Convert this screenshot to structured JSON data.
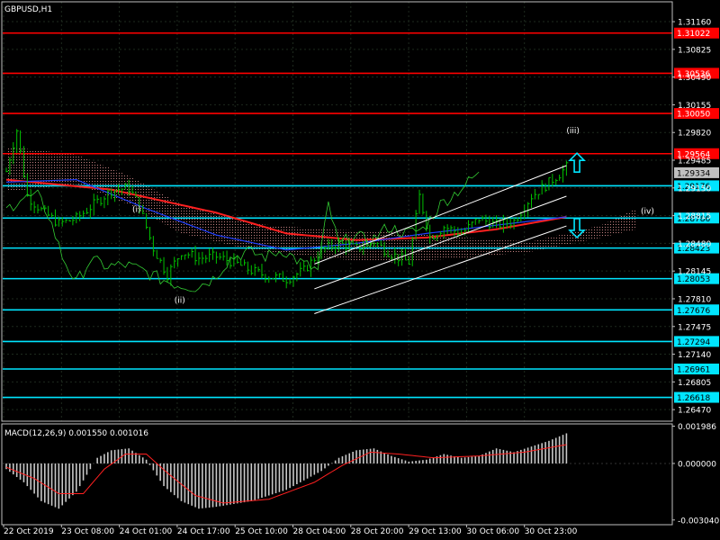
{
  "chart_data": [
    {
      "type": "line",
      "title": "GBPUSD,H1",
      "price_axis": {
        "ticks": [
          1.3116,
          1.30825,
          1.3049,
          1.30155,
          1.2982,
          1.29485,
          1.2915,
          1.28815,
          1.2848,
          1.28145,
          1.2781,
          1.27475,
          1.2714,
          1.26805,
          1.2647
        ],
        "tick_labels": [
          "1.31160",
          "1.30825",
          "1.30490",
          "1.30155",
          "1.29820",
          "1.29485",
          "1.29150",
          "1.28815",
          "1.28480",
          "1.28145",
          "1.27810",
          "1.27475",
          "1.27140",
          "1.26805",
          "1.26470"
        ],
        "range": [
          1.2633,
          1.314
        ]
      },
      "time_axis": {
        "labels": [
          "22 Oct 2019",
          "23 Oct 08:00",
          "24 Oct 01:00",
          "24 Oct 17:00",
          "25 Oct 10:00",
          "28 Oct 04:00",
          "28 Oct 20:00",
          "29 Oct 13:00",
          "30 Oct 06:00",
          "30 Oct 23:00"
        ],
        "bars_total": 176
      },
      "grid": true,
      "resistance_levels": [
        {
          "value": 1.31022,
          "label": "1.31022",
          "color": "#ff0000"
        },
        {
          "value": 1.30536,
          "label": "1.30536",
          "color": "#ff0000"
        },
        {
          "value": 1.3005,
          "label": "1.30050",
          "color": "#ff0000"
        },
        {
          "value": 1.29564,
          "label": "1.29564",
          "color": "#ff0000"
        }
      ],
      "support_levels": [
        {
          "value": 1.29176,
          "label": "1.29176",
          "color": "#00e5ff"
        },
        {
          "value": 1.28786,
          "label": "1.28786",
          "color": "#00e5ff"
        },
        {
          "value": 1.28423,
          "label": "1.28423",
          "color": "#00e5ff"
        },
        {
          "value": 1.28053,
          "label": "1.28053",
          "color": "#00e5ff"
        },
        {
          "value": 1.27676,
          "label": "1.27676",
          "color": "#00e5ff"
        },
        {
          "value": 1.27294,
          "label": "1.27294",
          "color": "#00e5ff"
        },
        {
          "value": 1.26961,
          "label": "1.26961",
          "color": "#00e5ff"
        },
        {
          "value": 1.26618,
          "label": "1.26618",
          "color": "#00e5ff"
        }
      ],
      "current_price": {
        "value": 1.29334,
        "label": "1.29334",
        "color": "#c0c0c0"
      },
      "wave_labels": [
        {
          "text": "(i)",
          "bar": 36,
          "price": 1.2886
        },
        {
          "text": "(ii)",
          "bar": 48,
          "price": 1.2776
        },
        {
          "text": "(iii)",
          "bar": 160,
          "price": 1.2981
        },
        {
          "text": "(iv)",
          "bar": 182,
          "price": 1.2884
        }
      ],
      "arrows": [
        {
          "direction": "up",
          "bar": 163,
          "price": 1.2945,
          "color": "#00e5ff"
        },
        {
          "direction": "down",
          "bar": 163,
          "price": 1.2867,
          "color": "#00e5ff"
        }
      ],
      "channel": {
        "color": "#ffffff",
        "lines": [
          {
            "from": {
              "bar": 88,
              "price": 1.2823
            },
            "to": {
              "bar": 160,
              "price": 1.2942
            }
          },
          {
            "from": {
              "bar": 88,
              "price": 1.2793
            },
            "to": {
              "bar": 160,
              "price": 1.2905
            }
          },
          {
            "from": {
              "bar": 88,
              "price": 1.2763
            },
            "to": {
              "bar": 160,
              "price": 1.2869
            }
          }
        ]
      },
      "price_anchors": [
        [
          0,
          1.2935
        ],
        [
          3,
          1.2985
        ],
        [
          6,
          1.2905
        ],
        [
          10,
          1.2888
        ],
        [
          15,
          1.2872
        ],
        [
          20,
          1.2878
        ],
        [
          25,
          1.2895
        ],
        [
          30,
          1.2912
        ],
        [
          35,
          1.2915
        ],
        [
          38,
          1.2893
        ],
        [
          42,
          1.2842
        ],
        [
          46,
          1.281
        ],
        [
          50,
          1.2838
        ],
        [
          55,
          1.283
        ],
        [
          60,
          1.2832
        ],
        [
          65,
          1.2825
        ],
        [
          70,
          1.2815
        ],
        [
          75,
          1.2808
        ],
        [
          80,
          1.2805
        ],
        [
          85,
          1.2815
        ],
        [
          90,
          1.284
        ],
        [
          95,
          1.2848
        ],
        [
          100,
          1.2842
        ],
        [
          105,
          1.285
        ],
        [
          110,
          1.2835
        ],
        [
          115,
          1.2825
        ],
        [
          118,
          1.2905
        ],
        [
          121,
          1.2855
        ],
        [
          125,
          1.2868
        ],
        [
          130,
          1.286
        ],
        [
          135,
          1.2878
        ],
        [
          140,
          1.287
        ],
        [
          145,
          1.2875
        ],
        [
          150,
          1.2905
        ],
        [
          154,
          1.2918
        ],
        [
          158,
          1.2932
        ],
        [
          160,
          1.294
        ]
      ],
      "series": [
        {
          "name": "MA-red",
          "color": "#ff2020",
          "anchors": [
            [
              0,
              1.2925
            ],
            [
              30,
              1.2913
            ],
            [
              60,
              1.2885
            ],
            [
              80,
              1.286
            ],
            [
              100,
              1.2852
            ],
            [
              120,
              1.2855
            ],
            [
              140,
              1.2865
            ],
            [
              160,
              1.288
            ]
          ]
        },
        {
          "name": "MA-blue",
          "color": "#2040ff",
          "anchors": [
            [
              0,
              1.2922
            ],
            [
              20,
              1.2925
            ],
            [
              40,
              1.289
            ],
            [
              60,
              1.2858
            ],
            [
              80,
              1.284
            ],
            [
              100,
              1.2848
            ],
            [
              120,
              1.286
            ],
            [
              140,
              1.287
            ],
            [
              160,
              1.288
            ]
          ]
        }
      ],
      "cloud": {
        "color": "#c08080",
        "upper": [
          [
            0,
            1.2965
          ],
          [
            20,
            1.2955
          ],
          [
            35,
            1.293
          ],
          [
            50,
            1.2895
          ],
          [
            70,
            1.2872
          ],
          [
            90,
            1.2865
          ],
          [
            110,
            1.2862
          ],
          [
            130,
            1.2855
          ],
          [
            150,
            1.285
          ],
          [
            170,
            1.287
          ],
          [
            180,
            1.289
          ]
        ],
        "lower": [
          [
            0,
            1.291
          ],
          [
            20,
            1.292
          ],
          [
            35,
            1.2895
          ],
          [
            50,
            1.286
          ],
          [
            70,
            1.284
          ],
          [
            90,
            1.283
          ],
          [
            110,
            1.2825
          ],
          [
            130,
            1.283
          ],
          [
            150,
            1.2838
          ],
          [
            170,
            1.2855
          ],
          [
            180,
            1.2865
          ]
        ]
      }
    },
    {
      "type": "bar",
      "title": "MACD(12,26,9) 0.001550 0.001016",
      "yticks": [
        0.00198,
        0.0,
        -0.003
      ],
      "ytick_labels": [
        "0.001986",
        "0.000000",
        "-0.003040"
      ],
      "ylim": [
        -0.00325,
        0.0021
      ],
      "histogram_anchors": [
        [
          0,
          -0.0003
        ],
        [
          5,
          -0.001
        ],
        [
          10,
          -0.002
        ],
        [
          15,
          -0.0024
        ],
        [
          20,
          -0.0015
        ],
        [
          26,
          0.0003
        ],
        [
          30,
          0.0007
        ],
        [
          35,
          0.0008
        ],
        [
          40,
          0.0002
        ],
        [
          45,
          -0.0012
        ],
        [
          50,
          -0.002
        ],
        [
          55,
          -0.0024
        ],
        [
          60,
          -0.0023
        ],
        [
          70,
          -0.002
        ],
        [
          80,
          -0.0014
        ],
        [
          90,
          -0.0004
        ],
        [
          95,
          0.0003
        ],
        [
          100,
          0.0007
        ],
        [
          105,
          0.0008
        ],
        [
          110,
          0.0004
        ],
        [
          115,
          0.0001
        ],
        [
          120,
          0.0002
        ],
        [
          125,
          0.0005
        ],
        [
          130,
          0.0003
        ],
        [
          135,
          0.0004
        ],
        [
          140,
          0.0008
        ],
        [
          145,
          0.0006
        ],
        [
          150,
          0.0009
        ],
        [
          155,
          0.0012
        ],
        [
          160,
          0.0016
        ]
      ],
      "signal": {
        "name": "Signal",
        "color": "#ff2020",
        "anchors": [
          [
            0,
            -0.0002
          ],
          [
            8,
            -0.0008
          ],
          [
            15,
            -0.0016
          ],
          [
            22,
            -0.0016
          ],
          [
            28,
            -0.0003
          ],
          [
            34,
            0.0005
          ],
          [
            40,
            0.0005
          ],
          [
            46,
            -0.0005
          ],
          [
            54,
            -0.0017
          ],
          [
            62,
            -0.0021
          ],
          [
            75,
            -0.0019
          ],
          [
            88,
            -0.001
          ],
          [
            96,
            -0.0001
          ],
          [
            104,
            0.0006
          ],
          [
            112,
            0.0005
          ],
          [
            122,
            0.0003
          ],
          [
            135,
            0.0004
          ],
          [
            148,
            0.0006
          ],
          [
            160,
            0.001
          ]
        ]
      }
    }
  ]
}
